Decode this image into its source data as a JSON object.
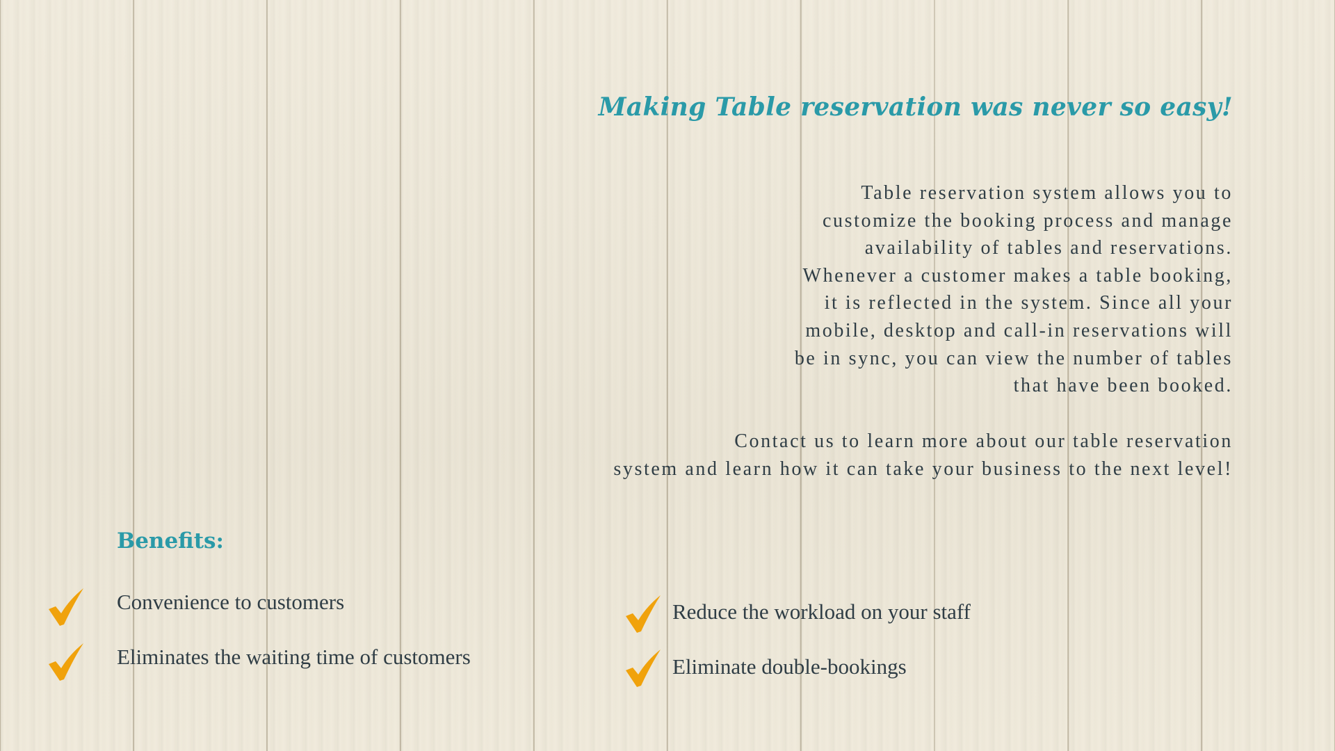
{
  "colors": {
    "accent": "#2a9aa8",
    "text": "#2f3d45",
    "check": "#f0a20c",
    "background": "#efe9d9"
  },
  "headline": "Making Table reservation was never so easy!",
  "description": [
    "Table reservation system allows you to",
    "customize the booking process and manage",
    "availability of tables and reservations.",
    "Whenever a customer makes a table booking,",
    "it is reflected in the system. Since all your",
    "mobile, desktop and call-in reservations will",
    "be in sync, you can view the number of tables",
    "that have been booked."
  ],
  "contact": [
    "Contact us to learn more about our table reservation",
    "system and learn how it can take your business to the next level!"
  ],
  "benefits": {
    "title": "Benefits:",
    "icon": "checkmark-icon",
    "items": [
      "Convenience to customers",
      "Eliminates the waiting time of customers",
      "Reduce the workload on your staff",
      "Eliminate double-bookings"
    ]
  }
}
